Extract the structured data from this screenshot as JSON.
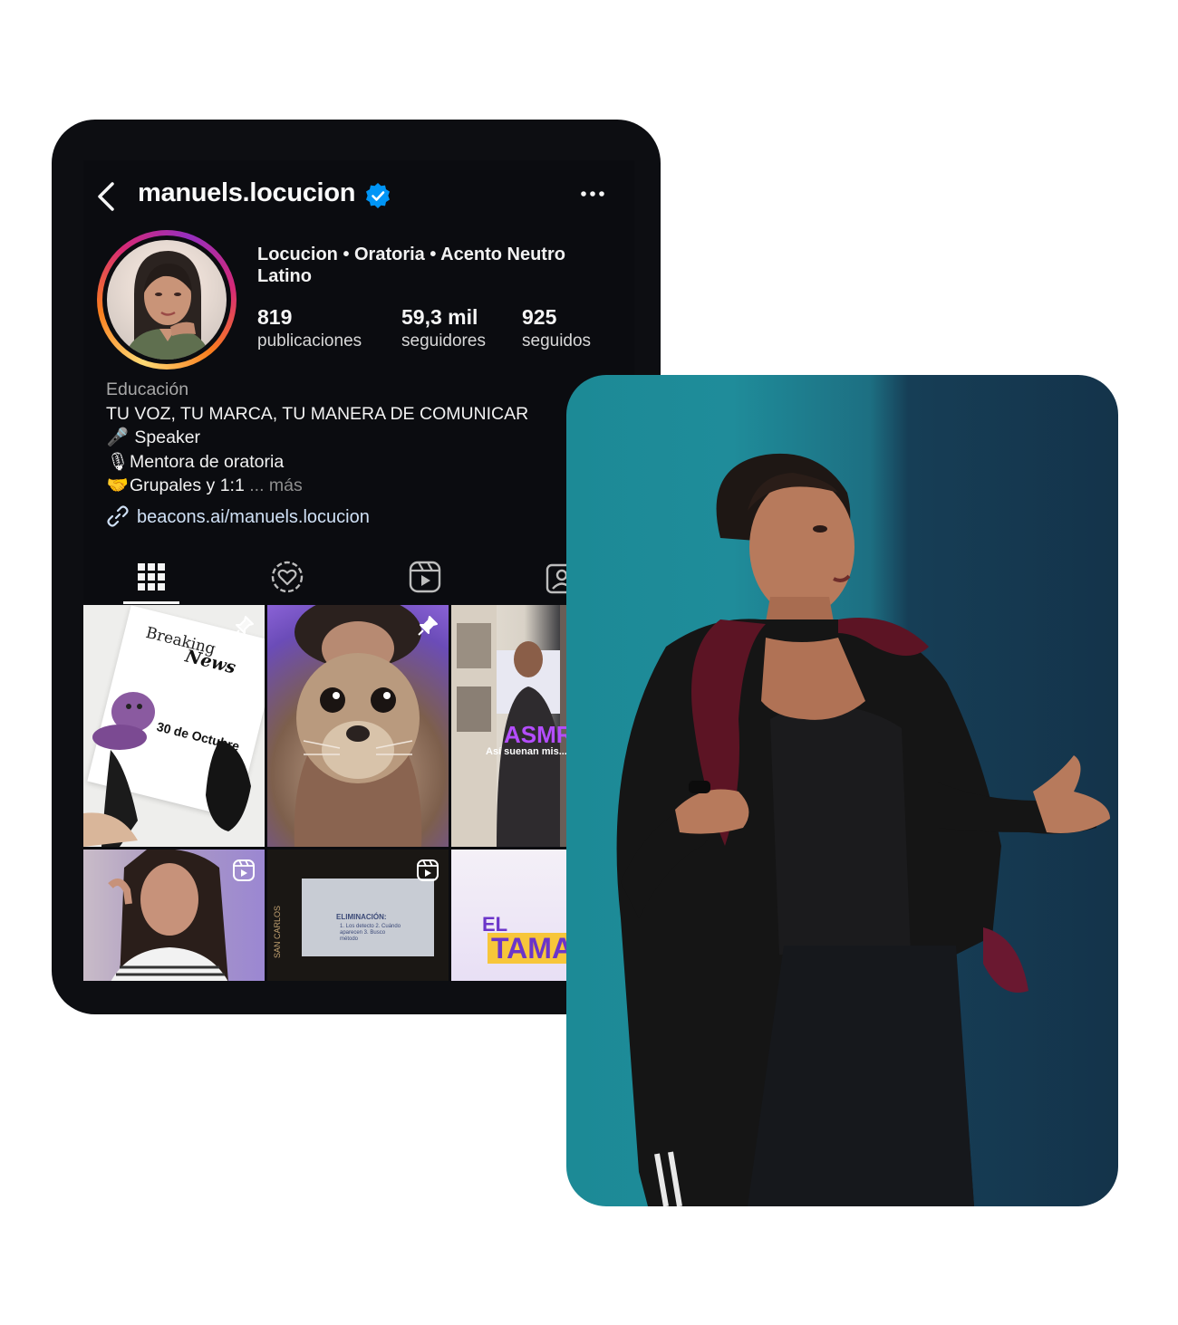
{
  "profile": {
    "username": "manuels.locucion",
    "headline": "Locucion • Oratoria • Acento Neutro Latino",
    "stats": [
      {
        "value": "819",
        "label": "publicaciones"
      },
      {
        "value": "59,3 mil",
        "label": "seguidores"
      },
      {
        "value": "925",
        "label": "seguidos"
      }
    ],
    "bio": {
      "category": "Educación",
      "line1": "TU VOZ, TU MARCA, TU MANERA DE COMUNICAR",
      "line2": "Speaker",
      "line3": "Mentora de oratoria",
      "line4": "Grupales y 1:1",
      "more": "... más"
    },
    "link": "beacons.ai/manuels.locucion"
  },
  "icons": {
    "back": "chevron-left-icon",
    "verified": "verified-badge-icon",
    "more": "more-horizontal-icon",
    "tabs": [
      "grid-icon",
      "collab-heart-icon",
      "reels-icon",
      "tagged-icon"
    ]
  },
  "posts": {
    "p1": {
      "line1": "Breaking",
      "line2": "News",
      "date": "30 de Octubre"
    },
    "p3": {
      "title": "ASMR",
      "subtitle": "Así suenan mis..."
    },
    "p5": {
      "screen_title": "ELIMINACIÓN:",
      "screen_lines": "1. Los detecto 2. Cuándo aparecen 3. Busco método",
      "venue": "SAN CARLOS"
    },
    "p6": {
      "line1": "EL",
      "line2": "TAMA"
    }
  },
  "colors": {
    "accent_blue": "#0095f6",
    "background_dark": "#0b0c10",
    "stage_teal": "#1f8c9a"
  }
}
